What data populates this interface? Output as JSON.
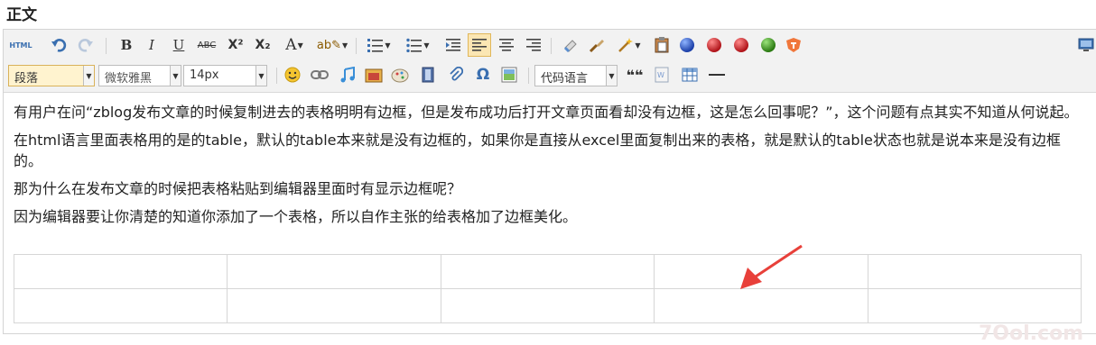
{
  "section_title": "正文",
  "toolbar": {
    "html_label": "HTML",
    "bold": "B",
    "italic": "I",
    "underline": "U",
    "strikethrough": "ABC",
    "superscript": "X²",
    "subscript": "X₂",
    "font_color": "A",
    "paragraph_select": "段落",
    "font_family_select": "微软雅黑",
    "font_size_select": "14px",
    "code_language_select": "代码语言",
    "quote": "❝❝",
    "icons": [
      "html-source",
      "undo",
      "redo",
      "bold",
      "italic",
      "underline",
      "strikethrough",
      "superscript",
      "subscript",
      "font-color",
      "highlight",
      "ordered-list",
      "unordered-list",
      "outdent",
      "align-left",
      "align-center",
      "align-right",
      "eraser",
      "format-brush",
      "magic",
      "paste-text",
      "blue-gem",
      "red-gem",
      "red-gem-2",
      "green-gem",
      "shield",
      "fullscreen",
      "emoji",
      "link",
      "music",
      "image",
      "insert-image",
      "video",
      "attachment",
      "omega",
      "image-manager",
      "quote",
      "word-paste",
      "table",
      "horizontal-rule"
    ]
  },
  "content": {
    "paragraphs": [
      "有用户在问“zblog发布文章的时候复制进去的表格明明有边框，但是发布成功后打开文章页面看却没有边框，这是怎么回事呢？”，这个问题有点其实不知道从何说起。",
      "在html语言里面表格用的是的table，默认的table本来就是没有边框的，如果你是直接从excel里面复制出来的表格，就是默认的table状态也就是说本来是没有边框的。",
      "那为什么在发布文章的时候把表格粘贴到编辑器里面时有显示边框呢？",
      "因为编辑器要让你清楚的知道你添加了一个表格，所以自作主张的给表格加了边框美化。"
    ],
    "table": {
      "rows": 2,
      "cols": 5
    }
  },
  "watermark": "7Ool.com",
  "colors": {
    "accent_red": "#e8403a",
    "toolbar_bg": "#f2f2f2"
  }
}
